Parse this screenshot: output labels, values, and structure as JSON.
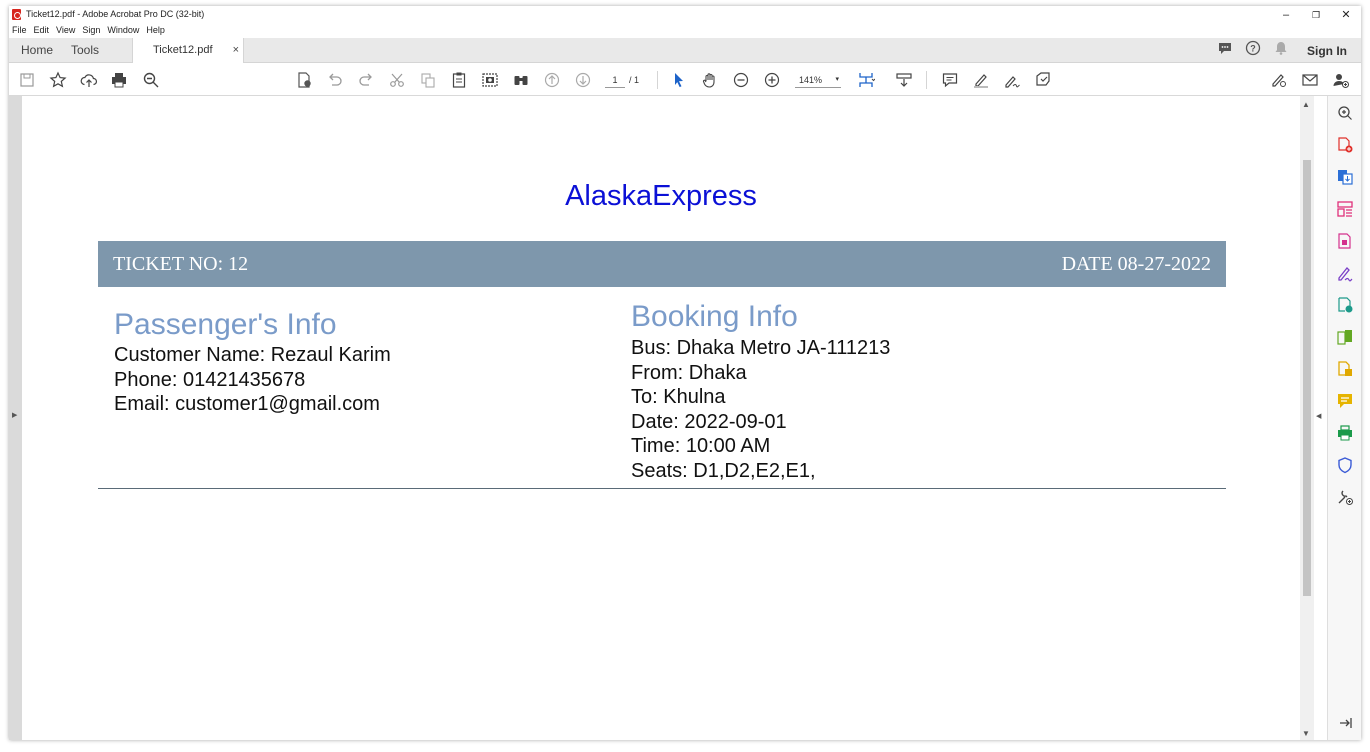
{
  "window": {
    "title": "Ticket12.pdf - Adobe Acrobat Pro DC (32-bit)",
    "controls": [
      "–",
      "❐",
      "✕"
    ]
  },
  "menu": [
    "File",
    "Edit",
    "View",
    "Sign",
    "Window",
    "Help"
  ],
  "tabs": {
    "home": "Home",
    "tools": "Tools",
    "document": "Ticket12.pdf",
    "close": "×",
    "sign_in": "Sign In"
  },
  "toolbar": {
    "page_current": "1",
    "page_total": "/ 1",
    "zoom": "141%",
    "zoom_caret": "▾"
  },
  "document": {
    "brand": "AlaskaExpress",
    "ticket_no": "TICKET NO: 12",
    "date": "DATE 08-27-2022",
    "passenger": {
      "title": "Passenger's Info",
      "lines": [
        "Customer Name: Rezaul Karim",
        "Phone: 01421435678",
        "Email: customer1@gmail.com"
      ]
    },
    "booking": {
      "title": "Booking Info",
      "lines": [
        "Bus: Dhaka Metro JA-111213",
        "From: Dhaka",
        "To: Khulna",
        "Date: 2022-09-01",
        "Time: 10:00 AM",
        "Seats: D1,D2,E2,E1,"
      ]
    }
  },
  "colors": {
    "brand": "#0b10d6",
    "ticket_bar": "#7e97ac",
    "section_title": "#7a9bc9",
    "acrobat_red": "#d7261e"
  }
}
